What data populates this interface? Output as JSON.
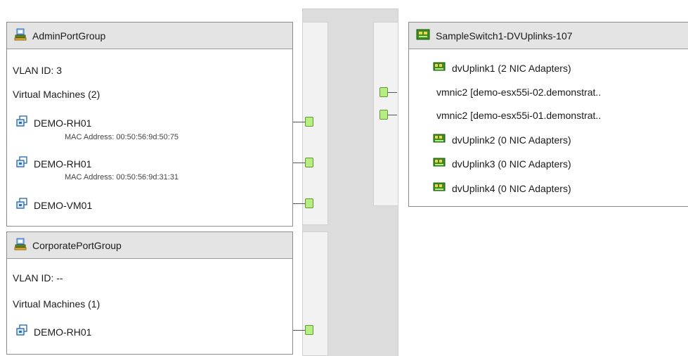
{
  "port_groups": [
    {
      "name": "AdminPortGroup",
      "vlan": "VLAN ID: 3",
      "vm_header": "Virtual Machines (2)",
      "vms": [
        {
          "name": "DEMO-RH01",
          "mac": "MAC Address: 00:50:56:9d:50:75"
        },
        {
          "name": "DEMO-RH01",
          "mac": "MAC Address: 00:50:56:9d:31:31"
        },
        {
          "name": "DEMO-VM01"
        }
      ]
    },
    {
      "name": "CorporatePortGroup",
      "vlan": "VLAN ID: --",
      "vm_header": "Virtual Machines (1)",
      "vms": [
        {
          "name": "DEMO-RH01"
        }
      ]
    }
  ],
  "uplink_group": {
    "name": "SampleSwitch1-DVUplinks-107",
    "items": [
      {
        "type": "uplink",
        "label": "dvUplink1 (2 NIC Adapters)"
      },
      {
        "type": "nic",
        "label": "vmnic2 [demo-esx55i-02.demonstrat.."
      },
      {
        "type": "nic",
        "label": "vmnic2 [demo-esx55i-01.demonstrat.."
      },
      {
        "type": "uplink",
        "label": "dvUplink2 (0 NIC Adapters)"
      },
      {
        "type": "uplink",
        "label": "dvUplink3 (0 NIC Adapters)"
      },
      {
        "type": "uplink",
        "label": "dvUplink4 (0 NIC Adapters)"
      }
    ]
  },
  "icons": {
    "port_group": "network-port-group-icon",
    "vm": "virtual-machine-icon",
    "uplink": "nic-card-icon",
    "uplink_group": "uplink-group-icon"
  },
  "colors": {
    "port_fill": "#b8ec84",
    "port_border": "#5f9a2e",
    "vm_icon": "#2f6fb4",
    "nic_icon": "#3c8c22"
  }
}
